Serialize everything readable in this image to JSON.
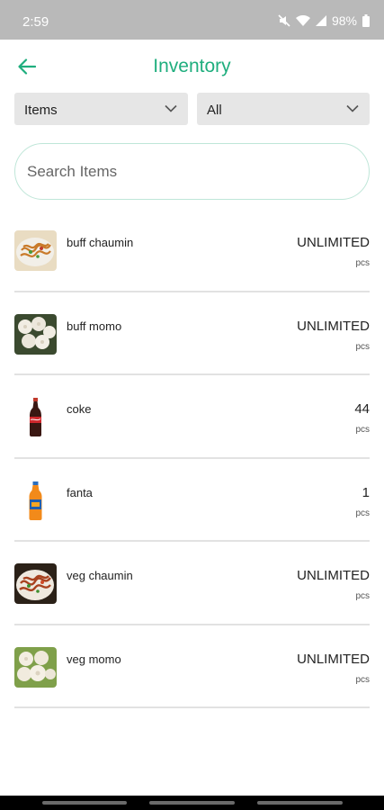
{
  "status_bar": {
    "time": "2:59",
    "battery": "98%"
  },
  "header": {
    "title": "Inventory"
  },
  "filters": {
    "type_value": "Items",
    "category_value": "All"
  },
  "search": {
    "placeholder": "Search Items",
    "value": ""
  },
  "items": [
    {
      "name": "buff chaumin",
      "qty": "UNLIMITED",
      "unit": "pcs",
      "image": "noodles-image"
    },
    {
      "name": "buff momo",
      "qty": "UNLIMITED",
      "unit": "pcs",
      "image": "momo-image"
    },
    {
      "name": "coke",
      "qty": "44",
      "unit": "pcs",
      "image": "coke-bottle-image"
    },
    {
      "name": "fanta",
      "qty": "1",
      "unit": "pcs",
      "image": "fanta-bottle-image"
    },
    {
      "name": "veg chaumin",
      "qty": "UNLIMITED",
      "unit": "pcs",
      "image": "noodles-image"
    },
    {
      "name": "veg momo",
      "qty": "UNLIMITED",
      "unit": "pcs",
      "image": "momo-image"
    }
  ],
  "colors": {
    "accent": "#1fae7e",
    "status_bar": "#b9b9b9",
    "dropdown_bg": "#e6e6e6"
  }
}
